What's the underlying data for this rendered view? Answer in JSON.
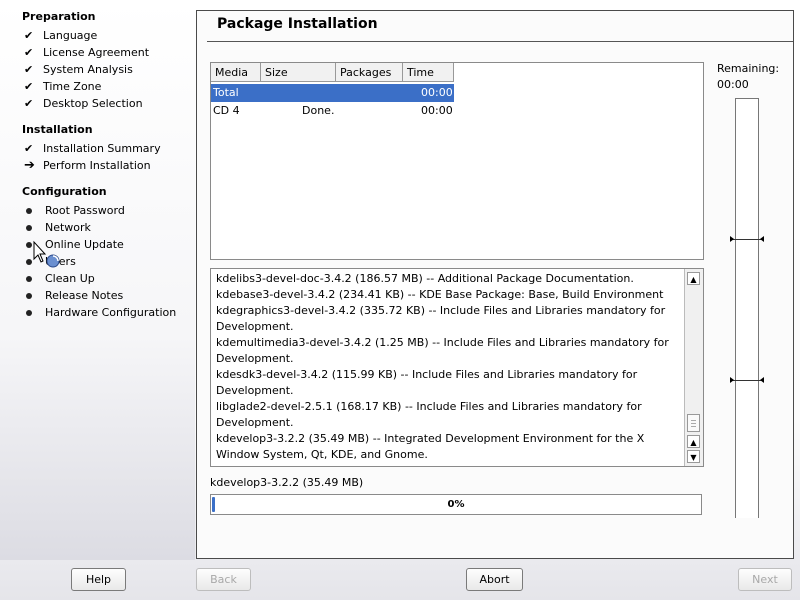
{
  "sidebar": {
    "sections": [
      {
        "title": "Preparation",
        "items": [
          {
            "label": "Language",
            "state": "done"
          },
          {
            "label": "License Agreement",
            "state": "done"
          },
          {
            "label": "System Analysis",
            "state": "done"
          },
          {
            "label": "Time Zone",
            "state": "done"
          },
          {
            "label": "Desktop Selection",
            "state": "done"
          }
        ]
      },
      {
        "title": "Installation",
        "items": [
          {
            "label": "Installation Summary",
            "state": "done"
          },
          {
            "label": "Perform Installation",
            "state": "current"
          }
        ]
      },
      {
        "title": "Configuration",
        "items": [
          {
            "label": "Root Password",
            "state": "pending"
          },
          {
            "label": "Network",
            "state": "pending"
          },
          {
            "label": "Online Update",
            "state": "pending"
          },
          {
            "label": "Users",
            "state": "pending"
          },
          {
            "label": "Clean Up",
            "state": "pending"
          },
          {
            "label": "Release Notes",
            "state": "pending"
          },
          {
            "label": "Hardware Configuration",
            "state": "pending"
          }
        ]
      }
    ]
  },
  "main": {
    "title": "Package Installation",
    "table": {
      "headers": [
        "Media",
        "Size",
        "Packages",
        "Time"
      ],
      "rows": [
        {
          "media": "Total",
          "size": "",
          "packages": "",
          "time": "00:00",
          "selected": true
        },
        {
          "media": "CD 4",
          "size": "Done.",
          "packages": "",
          "time": "00:00",
          "selected": false
        }
      ]
    },
    "log_lines": [
      "kdelibs3-devel-doc-3.4.2 (186.57 MB) -- Additional Package Documentation.",
      "kdebase3-devel-3.4.2 (234.41 KB) -- KDE Base Package: Base, Build Environment",
      "kdegraphics3-devel-3.4.2 (335.72 KB) -- Include Files and Libraries mandatory for Development.",
      "kdemultimedia3-devel-3.4.2 (1.25 MB) -- Include Files and Libraries mandatory for Development.",
      "kdesdk3-devel-3.4.2 (115.99 KB) -- Include Files and Libraries mandatory for Development.",
      "libglade2-devel-2.5.1 (168.17 KB) -- Include Files and Libraries mandatory for Development.",
      "kdevelop3-3.2.2 (35.49 MB) -- Integrated Development Environment for the X Window System, Qt, KDE, and Gnome."
    ],
    "current_package": "kdevelop3-3.2.2 (35.49 MB)",
    "progress_text": "0%",
    "progress_fraction": 0.0,
    "remaining_label": "Remaining:",
    "remaining_time": "00:00"
  },
  "buttons": {
    "help": "Help",
    "back": "Back",
    "abort": "Abort",
    "next": "Next"
  },
  "colors": {
    "selection": "#3b6fc7"
  }
}
